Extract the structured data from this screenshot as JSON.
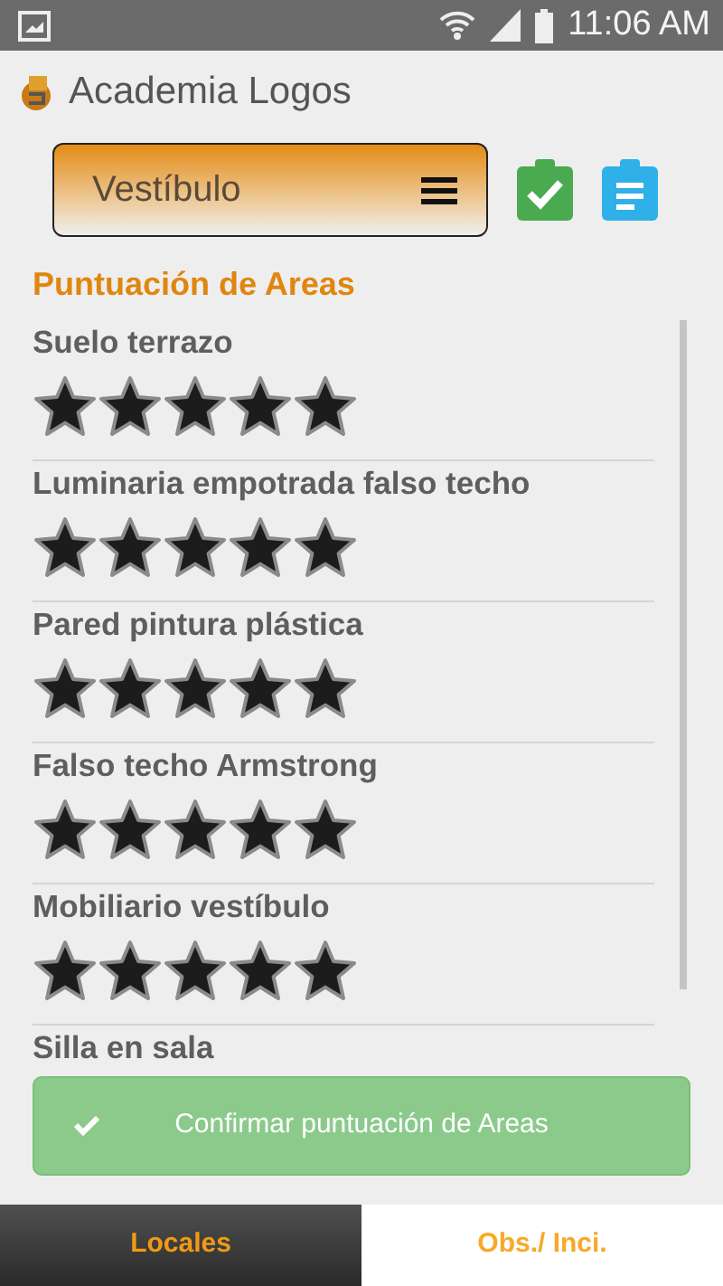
{
  "status_bar": {
    "time": "11:06 AM"
  },
  "app_bar": {
    "title": "Academia Logos"
  },
  "location_select": {
    "value": "Vestíbulo"
  },
  "section_title": "Puntuación de Areas",
  "areas": [
    {
      "name": "Suelo terrazo",
      "stars": 5
    },
    {
      "name": "Luminaria empotrada falso techo",
      "stars": 5
    },
    {
      "name": "Pared pintura plástica",
      "stars": 5
    },
    {
      "name": "Falso techo Armstrong",
      "stars": 5
    },
    {
      "name": "Mobiliario vestíbulo",
      "stars": 5
    },
    {
      "name": "Silla en sala"
    }
  ],
  "confirm_button": "Confirmar puntuación de Areas",
  "tabs": [
    {
      "label": "Locales",
      "selected": true
    },
    {
      "label": "Obs./ Inci.",
      "selected": false
    }
  ]
}
